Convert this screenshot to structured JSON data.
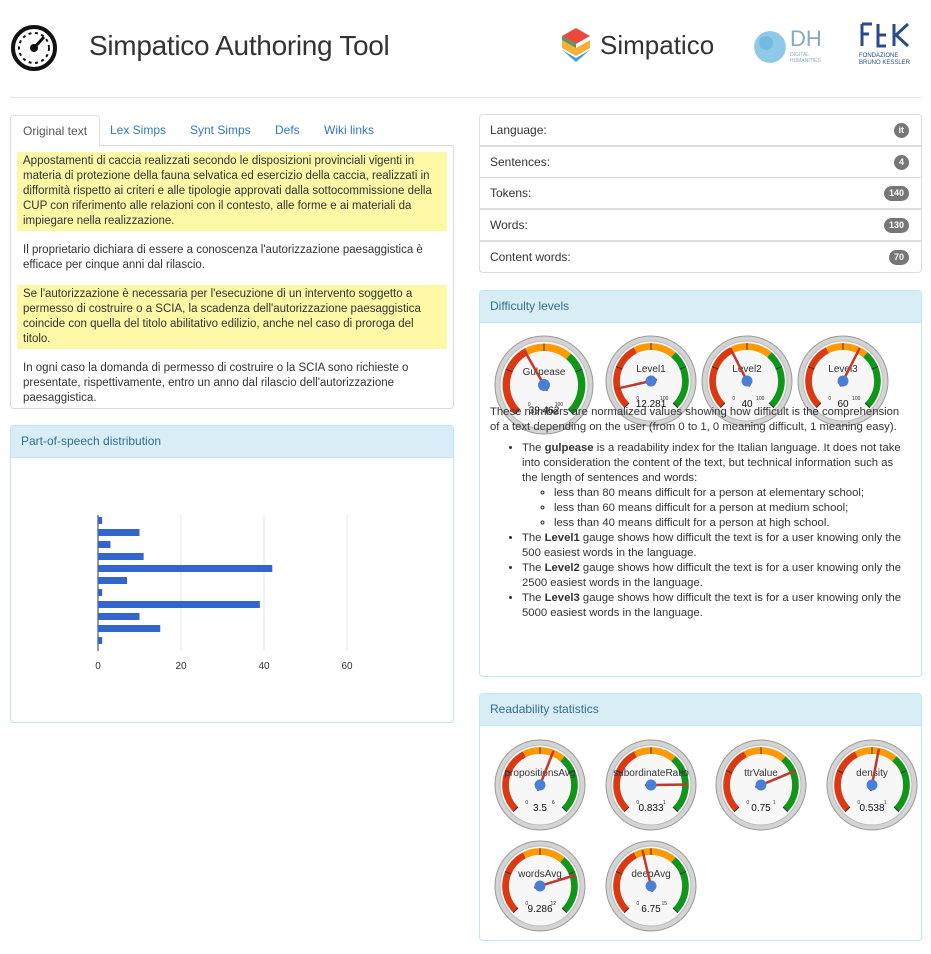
{
  "header": {
    "title": "Simpatico Authoring Tool",
    "brand_name": "Simpatico",
    "dh_label": "DH",
    "dh_sub1": "DIGITAL",
    "dh_sub2": "HUMANITIES",
    "fbk_sub1": "FONDAZIONE",
    "fbk_sub2": "BRUNO KESSLER"
  },
  "tabs": [
    {
      "label": "Original text",
      "active": true
    },
    {
      "label": "Lex Simps"
    },
    {
      "label": "Synt Simps"
    },
    {
      "label": "Defs"
    },
    {
      "label": "Wiki links"
    }
  ],
  "paragraphs": [
    {
      "text": "Appostamenti di caccia realizzati secondo le disposizioni provinciali vigenti in materia di protezione della fauna selvatica ed esercizio della caccia, realizzati in difformità rispetto ai criteri e alle tipologie approvati dalla sottocommissione della CUP con riferimento alle relazioni con il contesto, alle forme e ai materiali da impiegare nella realizzazione.",
      "highlight": true
    },
    {
      "text": "Il proprietario dichiara di essere a conoscenza l'autorizzazione paesaggistica è efficace per cinque anni dal rilascio.",
      "highlight": false
    },
    {
      "text": "Se l'autorizzazione è necessaria per l'esecuzione di un intervento soggetto a permesso di costruire o a SCIA, la scadenza dell'autorizzazione paesaggistica coincide con quella del titolo abilitativo edilizio, anche nel caso di proroga del titolo.",
      "highlight": true
    },
    {
      "text": "In ogni caso la domanda di permesso di costruire o la SCIA sono richieste o presentate, rispettivamente, entro un anno dal rilascio dell'autorizzazione paesaggistica.",
      "highlight": false
    }
  ],
  "stats": [
    {
      "label": "Language:",
      "value": "it"
    },
    {
      "label": "Sentences:",
      "value": "4"
    },
    {
      "label": "Tokens:",
      "value": "140"
    },
    {
      "label": "Words:",
      "value": "130"
    },
    {
      "label": "Content words:",
      "value": "70"
    }
  ],
  "pos_panel": {
    "title": "Part-of-speech distribution"
  },
  "chart_data": {
    "type": "bar",
    "orientation": "horizontal",
    "values": [
      1,
      10,
      3,
      11,
      42,
      7,
      1,
      39,
      10,
      15,
      1
    ],
    "xlim": [
      0,
      65
    ],
    "xticks": [
      0,
      20,
      40,
      60
    ],
    "grid": true,
    "color": "#3366cc"
  },
  "difficulty": {
    "title": "Difficulty levels",
    "gauges": [
      {
        "label": "Gulpease",
        "value": "39.462",
        "fraction": 0.39,
        "min": "0",
        "max": "100"
      },
      {
        "label": "Level1",
        "value": "12.281",
        "fraction": 0.12,
        "min": "0",
        "max": "100"
      },
      {
        "label": "Level2",
        "value": "40",
        "fraction": 0.4,
        "min": "0",
        "max": "100"
      },
      {
        "label": "Level3",
        "value": "60",
        "fraction": 0.6,
        "min": "0",
        "max": "100"
      }
    ],
    "intro": "These numbers are normalized values showing how difficult is the comprehension of a text depending on the user (from 0 to 1, 0 meaning difficult, 1 meaning easy).",
    "b1_pre": "The ",
    "b1_bold": "gulpease",
    "b1_post": " is a readability index for the Italian language. It does not take into consideration the content of the text, but technical information such as the length of sentences and words:",
    "sub": [
      "less than 80 means difficult for a person at elementary school;",
      "less than 60 means difficult for a person at medium school;",
      "less than 40 means difficult for a person at high school."
    ],
    "b2_bold": "Level1",
    "b2_post": " gauge shows how difficult the text is for a user knowing only the 500 easiest words in the language.",
    "b3_bold": "Level2",
    "b3_post": " gauge shows how difficult the text is for a user knowing only the 2500 easiest words in the language.",
    "b4_bold": "Level3",
    "b4_post": " gauge shows how difficult the text is for a user knowing only the 5000 easiest words in the language."
  },
  "readability": {
    "title": "Readability statistics",
    "gauges": [
      {
        "label": "propositionsAvg",
        "value": "3.5",
        "fraction": 0.58,
        "min": "0",
        "max": "6"
      },
      {
        "label": "subordinateRatio",
        "value": "0.833",
        "fraction": 0.83,
        "min": "0",
        "max": "1"
      },
      {
        "label": "ttrValue",
        "value": "0.75",
        "fraction": 0.75,
        "min": "0",
        "max": "1"
      },
      {
        "label": "density",
        "value": "0.538",
        "fraction": 0.54,
        "min": "0",
        "max": "1"
      },
      {
        "label": "wordsAvg",
        "value": "9.286",
        "fraction": 0.77,
        "min": "0",
        "max": "12"
      },
      {
        "label": "deepAvg",
        "value": "6.75",
        "fraction": 0.45,
        "min": "0",
        "max": "15"
      }
    ]
  }
}
